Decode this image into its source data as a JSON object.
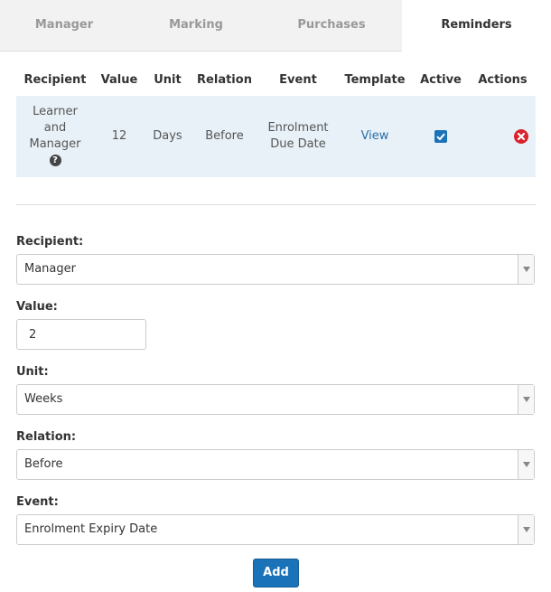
{
  "tabs": [
    {
      "label": "Manager",
      "active": false
    },
    {
      "label": "Marking",
      "active": false
    },
    {
      "label": "Purchases",
      "active": false
    },
    {
      "label": "Reminders",
      "active": true
    }
  ],
  "table": {
    "headers": [
      "Recipient",
      "Value",
      "Unit",
      "Relation",
      "Event",
      "Template",
      "Active",
      "Actions"
    ],
    "rows": [
      {
        "recipient_lines": [
          "Learner",
          "and",
          "Manager"
        ],
        "recipient_help_icon": "question-circle-icon",
        "value": "12",
        "unit": "Days",
        "relation": "Before",
        "event_lines": [
          "Enrolment",
          "Due Date"
        ],
        "template_link": "View",
        "active": true,
        "action_icon": "delete-icon"
      }
    ]
  },
  "form": {
    "recipient": {
      "label": "Recipient:",
      "value": "Manager"
    },
    "value": {
      "label": "Value:",
      "value": "2"
    },
    "unit": {
      "label": "Unit:",
      "value": "Weeks"
    },
    "relation": {
      "label": "Relation:",
      "value": "Before"
    },
    "event": {
      "label": "Event:",
      "value": "Enrolment Expiry Date"
    },
    "add_button": "Add"
  },
  "colors": {
    "accent": "#1a72b8",
    "row_highlight": "#e8f1f8",
    "delete": "#d9232d",
    "link": "#2a6fa8"
  }
}
